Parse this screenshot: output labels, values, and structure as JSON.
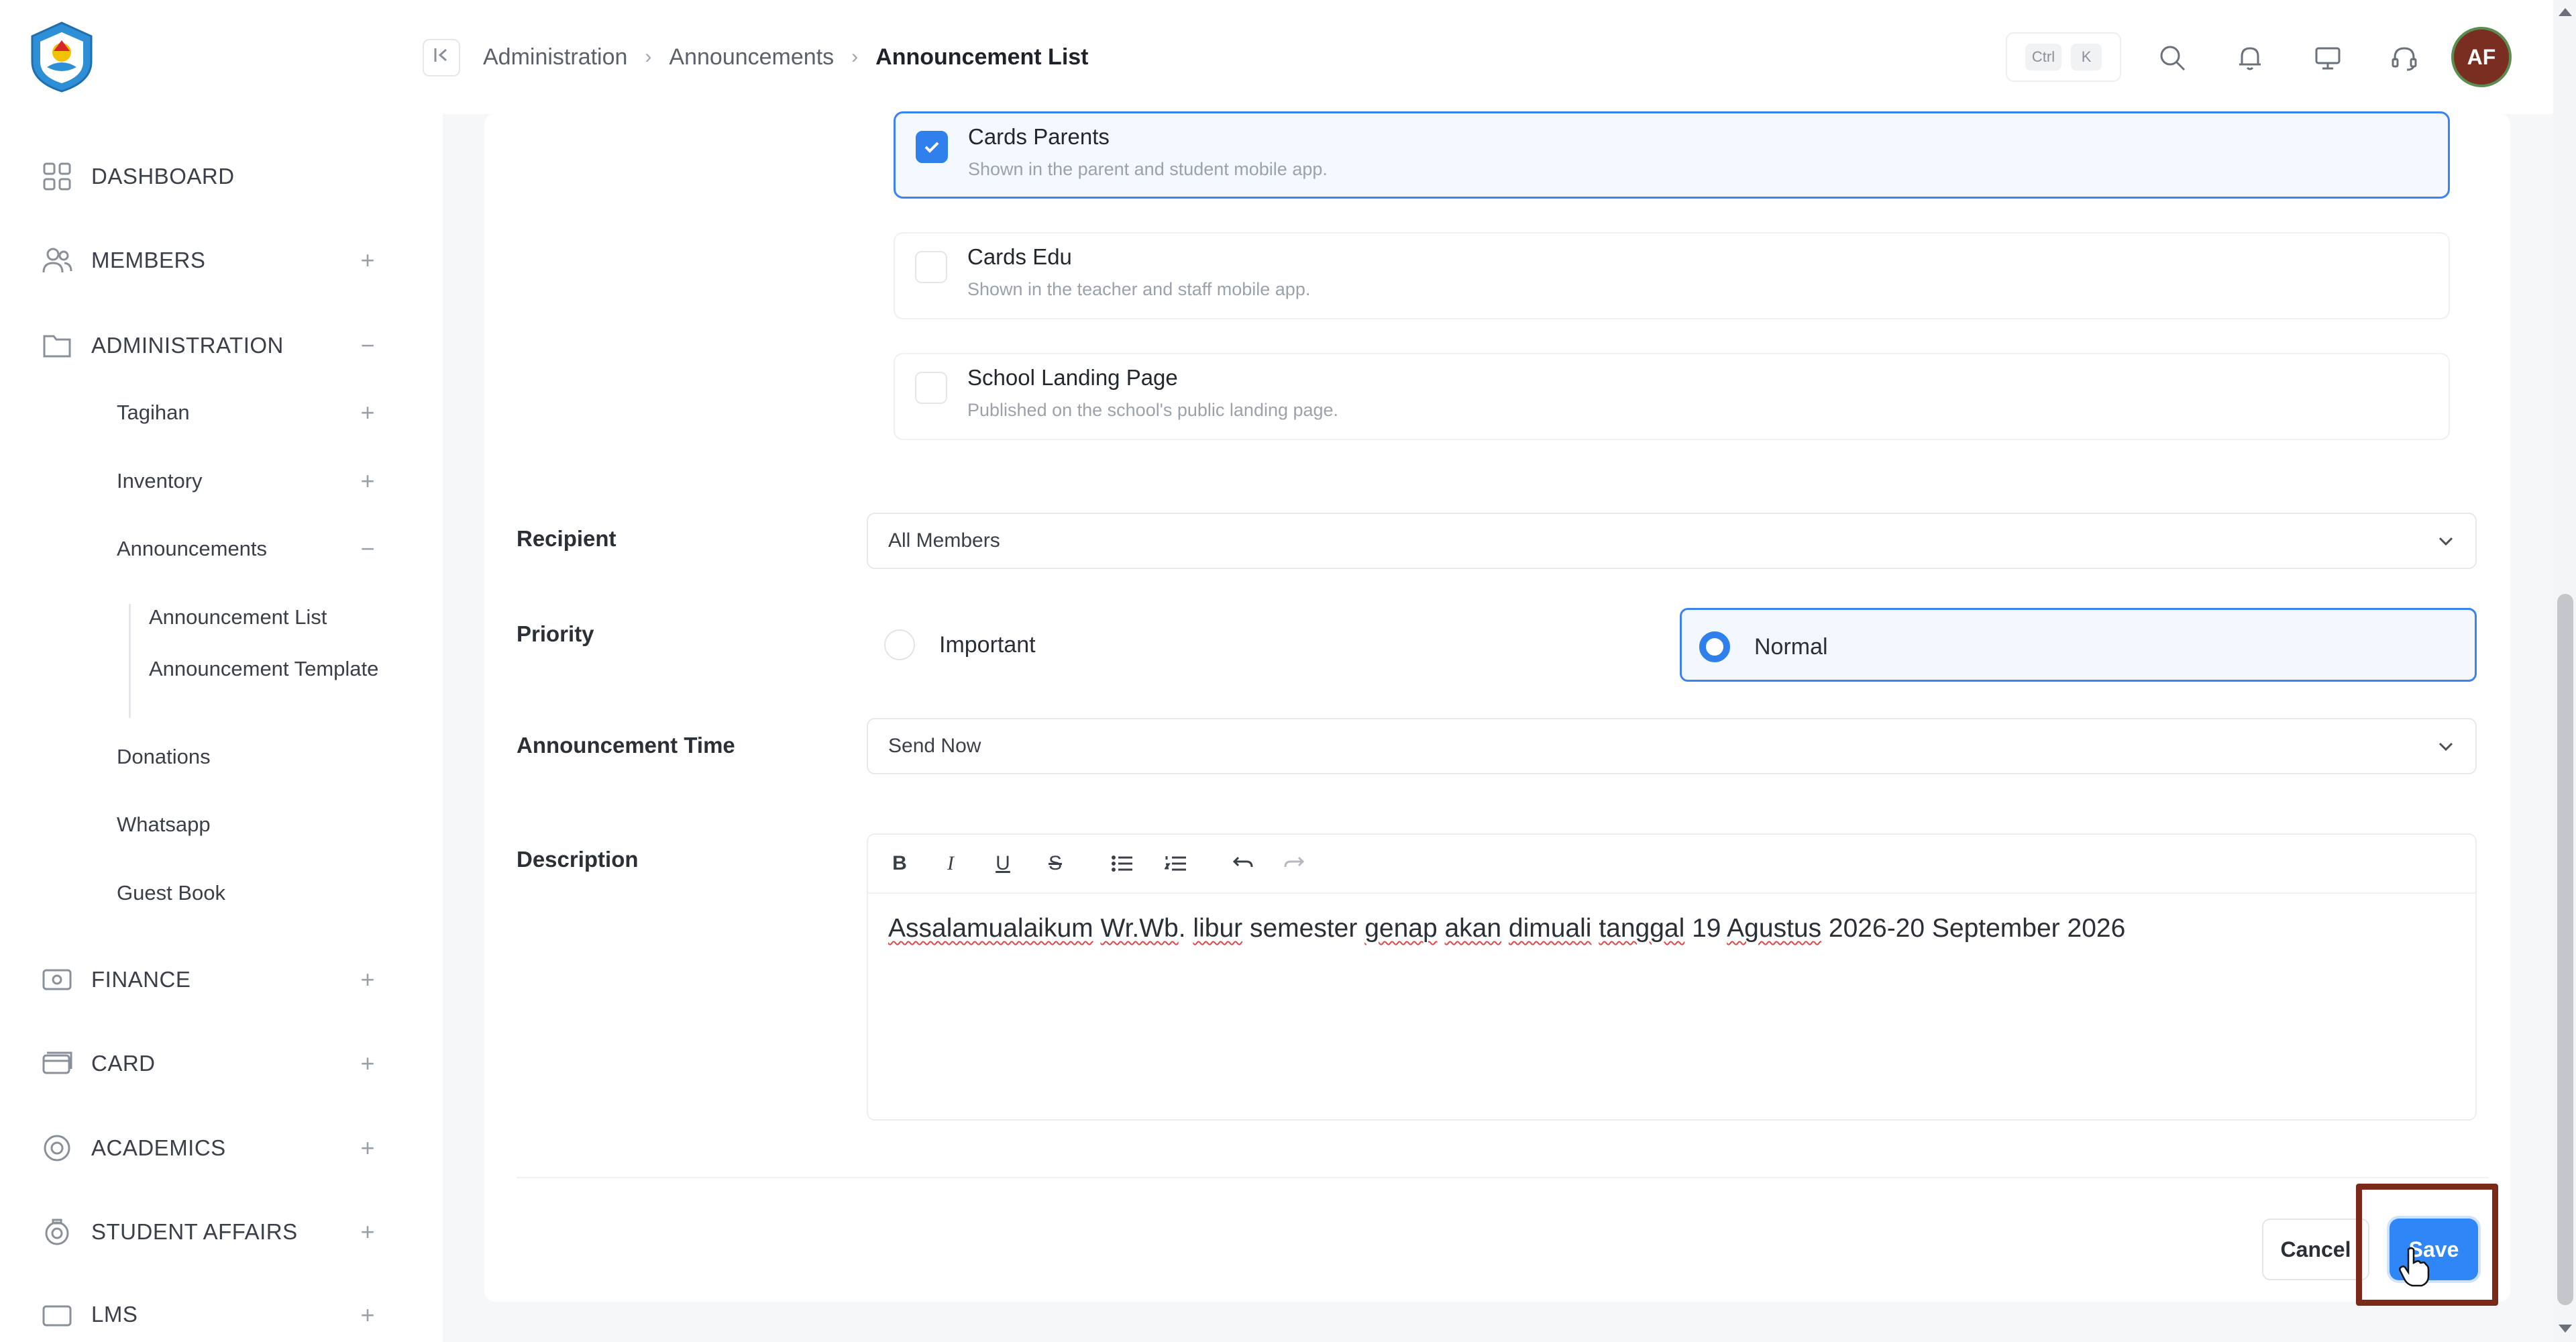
{
  "sidebar": {
    "items": [
      {
        "label": "DASHBOARD",
        "icon": "grid-icon",
        "toggle": ""
      },
      {
        "label": "MEMBERS",
        "icon": "users-icon",
        "toggle": "+"
      },
      {
        "label": "ADMINISTRATION",
        "icon": "folder-icon",
        "toggle": "−"
      },
      {
        "label": "FINANCE",
        "icon": "money-icon",
        "toggle": "+"
      },
      {
        "label": "CARD",
        "icon": "card-icon",
        "toggle": "+"
      },
      {
        "label": "ACADEMICS",
        "icon": "academics-icon",
        "toggle": "+"
      },
      {
        "label": "STUDENT AFFAIRS",
        "icon": "badge-icon",
        "toggle": "+"
      },
      {
        "label": "LMS",
        "icon": "lms-icon",
        "toggle": "+"
      }
    ],
    "admin_sub": [
      {
        "label": "Tagihan",
        "toggle": "+"
      },
      {
        "label": "Inventory",
        "toggle": "+"
      },
      {
        "label": "Announcements",
        "toggle": "−"
      },
      {
        "label": "Donations",
        "toggle": ""
      },
      {
        "label": "Whatsapp",
        "toggle": ""
      },
      {
        "label": "Guest Book",
        "toggle": ""
      }
    ],
    "announcement_sub": [
      {
        "label": "Announcement List"
      },
      {
        "label": "Announcement Template"
      }
    ]
  },
  "topbar": {
    "breadcrumb": [
      "Administration",
      "Announcements",
      "Announcement List"
    ],
    "shortcut": {
      "key1": "Ctrl",
      "key2": "K"
    },
    "avatar_initials": "AF"
  },
  "publish_options": [
    {
      "title": "Cards Parents",
      "description": "Shown in the parent and student mobile app.",
      "checked": true
    },
    {
      "title": "Cards Edu",
      "description": "Shown in the teacher and staff mobile app.",
      "checked": false
    },
    {
      "title": "School Landing Page",
      "description": "Published on the school's public landing page.",
      "checked": false
    }
  ],
  "form": {
    "recipient": {
      "label": "Recipient",
      "value": "All Members"
    },
    "priority": {
      "label": "Priority",
      "options": [
        "Important",
        "Normal"
      ],
      "selected": "Normal"
    },
    "announcement_time": {
      "label": "Announcement Time",
      "value": "Send Now"
    },
    "description": {
      "label": "Description",
      "text_segments": [
        {
          "t": "Assalamualaikum",
          "spell": true
        },
        {
          "t": " ",
          "spell": false
        },
        {
          "t": "Wr.Wb",
          "spell": true
        },
        {
          "t": ". ",
          "spell": false
        },
        {
          "t": "libur",
          "spell": true
        },
        {
          "t": " semester ",
          "spell": false
        },
        {
          "t": "genap",
          "spell": true
        },
        {
          "t": " ",
          "spell": false
        },
        {
          "t": "akan",
          "spell": true
        },
        {
          "t": " ",
          "spell": false
        },
        {
          "t": "dimuali",
          "spell": true
        },
        {
          "t": " ",
          "spell": false
        },
        {
          "t": "tanggal",
          "spell": true
        },
        {
          "t": " 19 ",
          "spell": false
        },
        {
          "t": "Agustus",
          "spell": true
        },
        {
          "t": " 2026-20 September 2026",
          "spell": false
        }
      ]
    }
  },
  "actions": {
    "cancel": "Cancel",
    "save": "Save"
  },
  "colors": {
    "accent": "#2f86f6",
    "highlight_frame": "#7b2a1a",
    "avatar_bg": "#7a2e22"
  }
}
